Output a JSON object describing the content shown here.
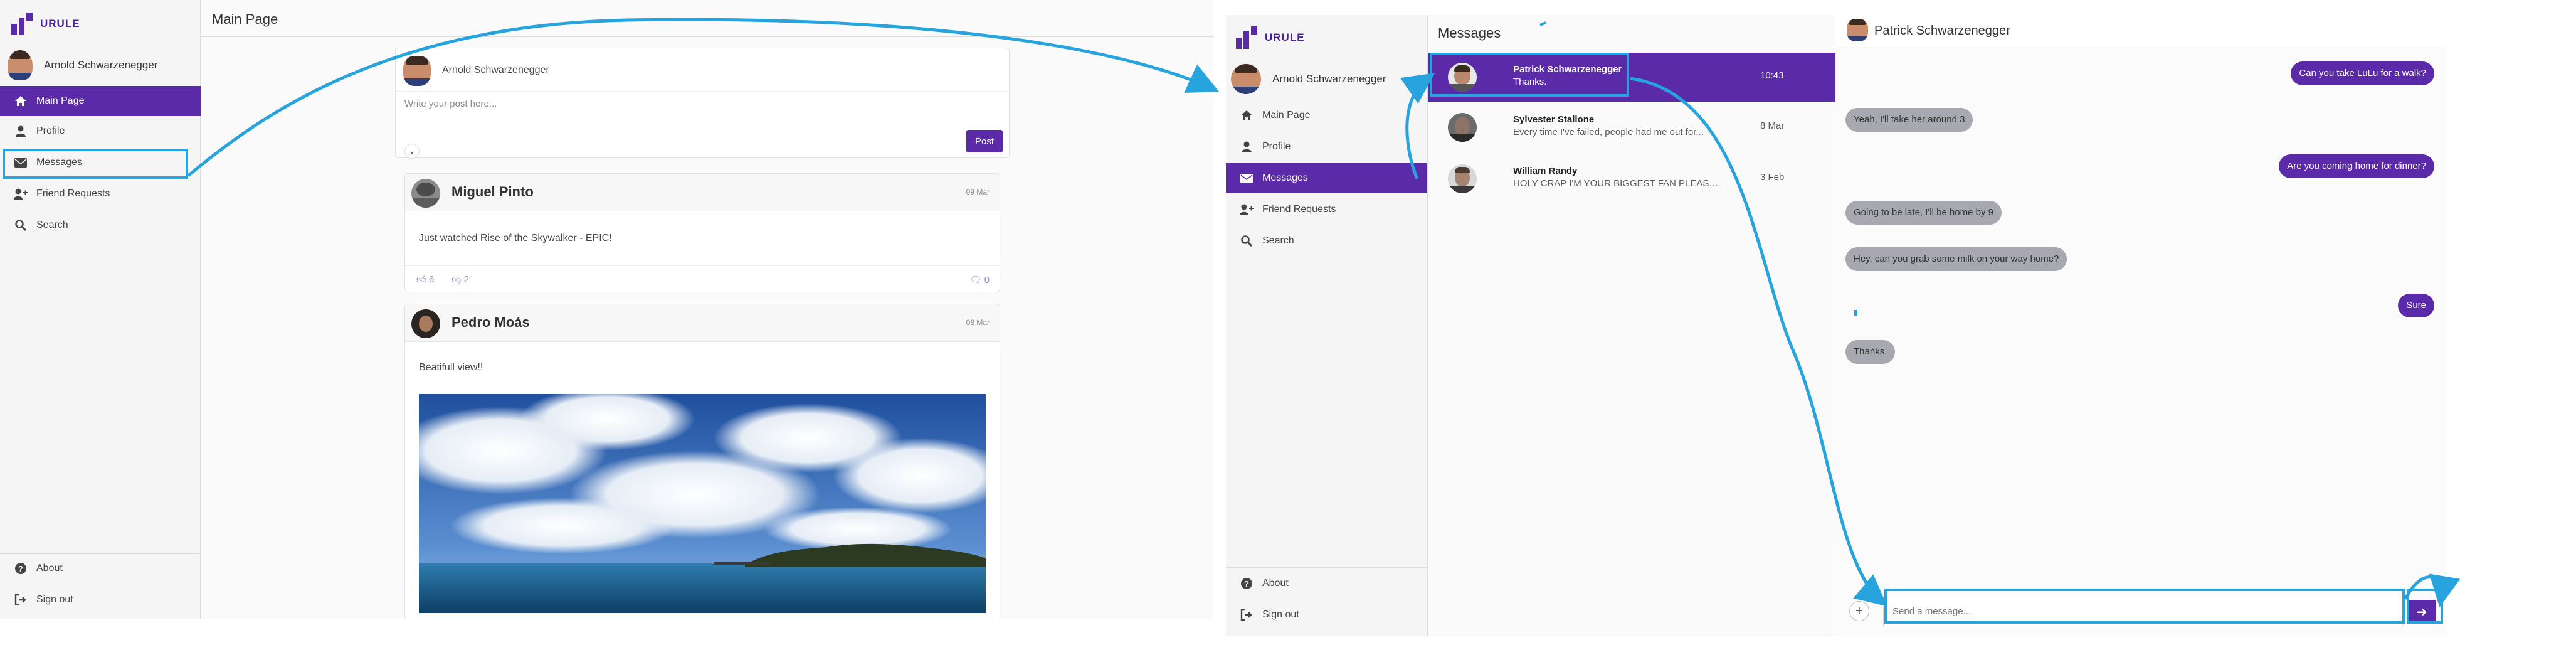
{
  "colors": {
    "accent": "#5b2aa8",
    "annotation": "#27a3dd",
    "incoming_bubble": "#a8a8b0"
  },
  "screen1": {
    "brand": "URULE",
    "user_name": "Arnold Schwarzenegger",
    "nav": [
      {
        "label": "Main Page",
        "icon": "home-icon",
        "active": true
      },
      {
        "label": "Profile",
        "icon": "user-icon"
      },
      {
        "label": "Messages",
        "icon": "envelope-icon"
      },
      {
        "label": "Friend Requests",
        "icon": "user-plus-icon"
      },
      {
        "label": "Search",
        "icon": "search-icon"
      }
    ],
    "footer_nav": [
      {
        "label": "About",
        "icon": "question-icon"
      },
      {
        "label": "Sign out",
        "icon": "sign-out-icon"
      }
    ],
    "page_title": "Main Page",
    "composer": {
      "user_name": "Arnold Schwarzenegger",
      "placeholder": "Write your post here...",
      "post_label": "Post"
    },
    "posts": [
      {
        "author": "Miguel Pinto",
        "date": "09 Mar",
        "text": "Just watched Rise of the Skywalker - EPIC!",
        "likes": "6",
        "dislikes": "2",
        "comments": "0"
      },
      {
        "author": "Pedro Moás",
        "date": "08 Mar",
        "text": "Beatifull view!!"
      }
    ]
  },
  "screen2": {
    "brand": "URULE",
    "user_name": "Arnold Schwarzenegger",
    "nav": [
      {
        "label": "Main Page",
        "icon": "home-icon"
      },
      {
        "label": "Profile",
        "icon": "user-icon"
      },
      {
        "label": "Messages",
        "icon": "envelope-icon",
        "active": true
      },
      {
        "label": "Friend Requests",
        "icon": "user-plus-icon"
      },
      {
        "label": "Search",
        "icon": "search-icon"
      }
    ],
    "footer_nav": [
      {
        "label": "About",
        "icon": "question-icon"
      },
      {
        "label": "Sign out",
        "icon": "sign-out-icon"
      }
    ],
    "messages_title": "Messages",
    "conversations": [
      {
        "name": "Patrick Schwarzenegger",
        "preview": "Thanks.",
        "time": "10:43",
        "active": true
      },
      {
        "name": "Sylvester Stallone",
        "preview": "Every time I've failed, people had me out for...",
        "time": "8 Mar"
      },
      {
        "name": "William Randy",
        "preview": "HOLY CRAP I'M YOUR BIGGEST FAN PLEASE ...",
        "time": "3 Feb"
      }
    ],
    "chat": {
      "contact_name": "Patrick Schwarzenegger",
      "messages": [
        {
          "dir": "out",
          "text": "Can you take LuLu for a walk?"
        },
        {
          "dir": "in",
          "text": "Yeah, I'll take her around 3"
        },
        {
          "dir": "out",
          "text": "Are you coming home for dinner?"
        },
        {
          "dir": "in",
          "text": "Going to be late, I'll be home by 9"
        },
        {
          "dir": "in",
          "text": "Hey, can you grab some milk on your way home?"
        },
        {
          "dir": "out",
          "text": "Sure"
        },
        {
          "dir": "in",
          "text": "Thanks."
        }
      ],
      "input_placeholder": "Send a message...",
      "send_icon": "arrow-right-icon",
      "add_icon": "plus-icon"
    }
  }
}
